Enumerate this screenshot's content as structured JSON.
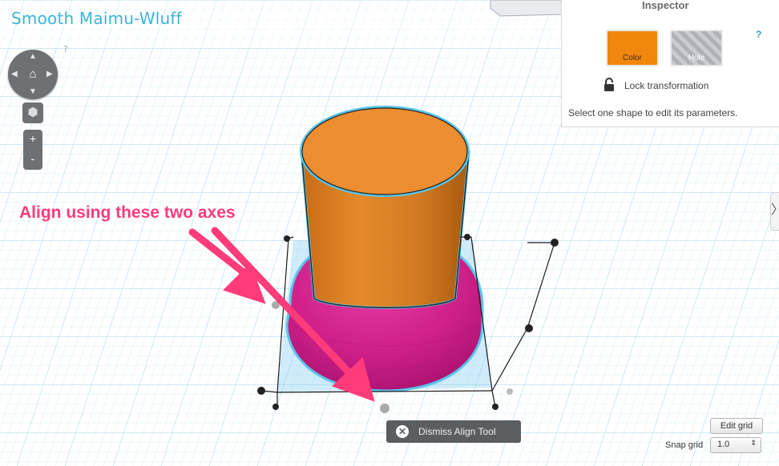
{
  "app": {
    "title": "Smooth Maimu-Wluff",
    "help_hint": "?"
  },
  "navigation": {
    "up": "▲",
    "down": "▼",
    "left": "◀",
    "right": "▶",
    "home": "⌂",
    "cube": "⬢",
    "zoom_in": "+",
    "zoom_out": "-"
  },
  "inspector": {
    "title": "Inspector",
    "help": "?",
    "color_label": "Color",
    "hole_label": "Hole",
    "lock_label": "Lock transformation",
    "hint": "Select one shape to edit its parameters.",
    "color_swatch": "#f2870d"
  },
  "collapse_tab": {
    "glyph": "〉"
  },
  "annotation": {
    "text": "Align using these two axes",
    "color": "#ff3b7a"
  },
  "align_tool": {
    "dismiss_label": "Dismiss Align Tool",
    "dismiss_icon": "✕"
  },
  "grid_controls": {
    "edit_label": "Edit grid",
    "snap_label": "Snap grid",
    "snap_value": "1.0",
    "snap_arrow": "⇕"
  },
  "colors": {
    "accent": "#3cb4d6",
    "grid": "#bfe3f1",
    "orange": "#e98a2f",
    "magenta": "#d4238f"
  }
}
